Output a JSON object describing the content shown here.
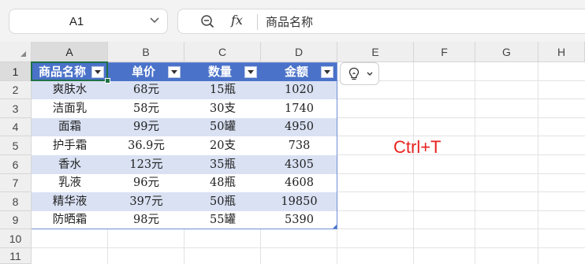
{
  "name_box": {
    "value": "A1"
  },
  "formula_bar": {
    "content": "商品名称"
  },
  "columns": [
    "A",
    "B",
    "C",
    "D",
    "E",
    "F",
    "G",
    "H"
  ],
  "rows": [
    "1",
    "2",
    "3",
    "4",
    "5",
    "6",
    "7",
    "8",
    "9",
    "10",
    "11"
  ],
  "table": {
    "headers": [
      "商品名称",
      "单价",
      "数量",
      "金额"
    ],
    "rows": [
      [
        "爽肤水",
        "68元",
        "15瓶",
        "1020"
      ],
      [
        "洁面乳",
        "58元",
        "30支",
        "1740"
      ],
      [
        "面霜",
        "99元",
        "50罐",
        "4950"
      ],
      [
        "护手霜",
        "36.9元",
        "20支",
        "738"
      ],
      [
        "香水",
        "123元",
        "35瓶",
        "4305"
      ],
      [
        "乳液",
        "96元",
        "48瓶",
        "4608"
      ],
      [
        "精华液",
        "397元",
        "50瓶",
        "19850"
      ],
      [
        "防晒霜",
        "98元",
        "55罐",
        "5390"
      ]
    ]
  },
  "annotation": "Ctrl+T",
  "colors": {
    "header": "#4a72c9",
    "band": "#d9e1f3",
    "selection": "#1e7145",
    "annotation": "#e8231f"
  }
}
